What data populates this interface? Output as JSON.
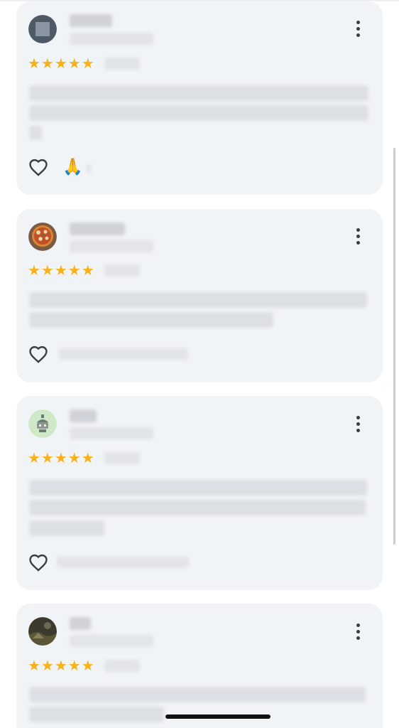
{
  "colors": {
    "card_bg": "#f1f4f7",
    "star": "#f6b11b",
    "icon": "#3a3d42",
    "redacted": "#dcdfe3"
  },
  "reviews": [
    {
      "avatar": "gray-square-avatar",
      "rating": 5,
      "stars": "★★★★★",
      "liked": false,
      "reaction": "🙏",
      "has_menu": true
    },
    {
      "avatar": "pizza-avatar",
      "rating": 5,
      "stars": "★★★★★",
      "liked": false,
      "has_menu": true
    },
    {
      "avatar": "robot-avatar",
      "rating": 5,
      "stars": "★★★★★",
      "liked": false,
      "has_menu": true
    },
    {
      "avatar": "photo-avatar",
      "rating": 5,
      "stars": "★★★★★",
      "liked": false,
      "has_menu": true
    }
  ],
  "icons": {
    "menu": "more-vertical-icon",
    "like": "heart-outline-icon"
  }
}
